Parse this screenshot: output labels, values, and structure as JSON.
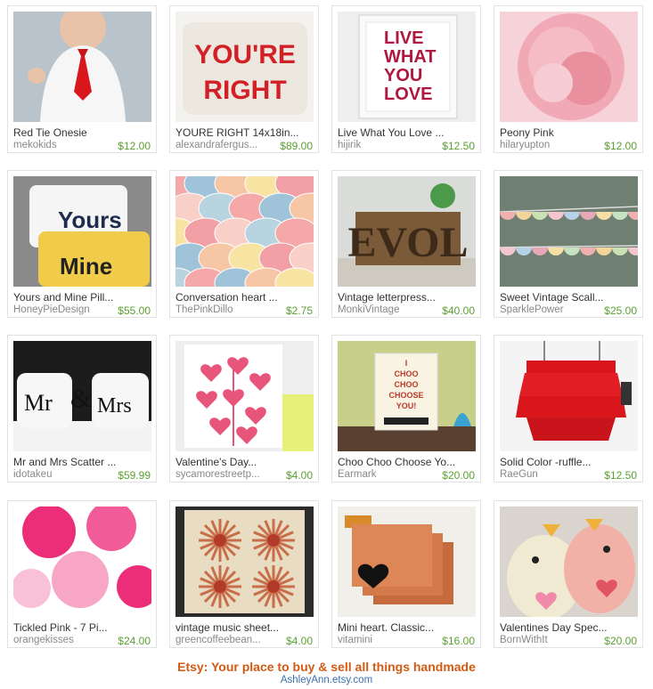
{
  "items": [
    {
      "title": "Red Tie Onesie",
      "seller": "mekokids",
      "price": "$12.00",
      "art": "onesie"
    },
    {
      "title": "YOURE RIGHT 14x18in...",
      "seller": "alexandrafergus...",
      "price": "$89.00",
      "art": "pillow-text",
      "art_text": [
        "YOU'RE",
        "RIGHT"
      ]
    },
    {
      "title": "Live What You Love ...",
      "seller": "hijirik",
      "price": "$12.50",
      "art": "print-frame",
      "art_text": [
        "LIVE",
        "WHAT",
        "YOU",
        "LOVE"
      ]
    },
    {
      "title": "Peony Pink",
      "seller": "hilaryupton",
      "price": "$12.00",
      "art": "peony"
    },
    {
      "title": "Yours and Mine Pill...",
      "seller": "HoneyPieDesign",
      "price": "$55.00",
      "art": "pillows-yours",
      "art_text": [
        "Yours",
        "Mine"
      ]
    },
    {
      "title": "Conversation heart ...",
      "seller": "ThePinkDillo",
      "price": "$2.75",
      "art": "hearts"
    },
    {
      "title": "Vintage letterpress...",
      "seller": "MonkiVintage",
      "price": "$40.00",
      "art": "letterpress",
      "art_text": [
        "EVOL"
      ]
    },
    {
      "title": "Sweet Vintage Scall...",
      "seller": "SparklePower",
      "price": "$25.00",
      "art": "bunting"
    },
    {
      "title": "Mr and Mrs Scatter ...",
      "seller": "idotakeu",
      "price": "$59.99",
      "art": "mrmrs",
      "art_text": [
        "Mr",
        "&",
        "Mrs"
      ]
    },
    {
      "title": "Valentine's Day...",
      "seller": "sycamorestreetp...",
      "price": "$4.00",
      "art": "card-hearts"
    },
    {
      "title": "Choo Choo Choose Yo...",
      "seller": "Earmark",
      "price": "$20.00",
      "art": "choo",
      "art_text": [
        "I",
        "CHOO",
        "CHOO",
        "CHOOSE",
        "YOU!"
      ]
    },
    {
      "title": "Solid Color -ruffle...",
      "seller": "RaeGun",
      "price": "$12.50",
      "art": "ruffle"
    },
    {
      "title": "Tickled Pink - 7 Pi...",
      "seller": "orangekisses",
      "price": "$24.00",
      "art": "pompoms"
    },
    {
      "title": "vintage music sheet...",
      "seller": "greencoffeebean...",
      "price": "$4.00",
      "art": "rosettes"
    },
    {
      "title": "Mini heart. Classic...",
      "seller": "vitamini",
      "price": "$16.00",
      "art": "coasters"
    },
    {
      "title": "Valentines Day Spec...",
      "seller": "BornWithIt",
      "price": "$20.00",
      "art": "birds"
    }
  ],
  "footer": {
    "tagline": "Etsy: Your place to buy & sell all things handmade",
    "link": "AshleyAnn.etsy.com"
  },
  "colors": {
    "price": "#5aa032",
    "tagline": "#d35a12",
    "link": "#3a6fb0"
  }
}
